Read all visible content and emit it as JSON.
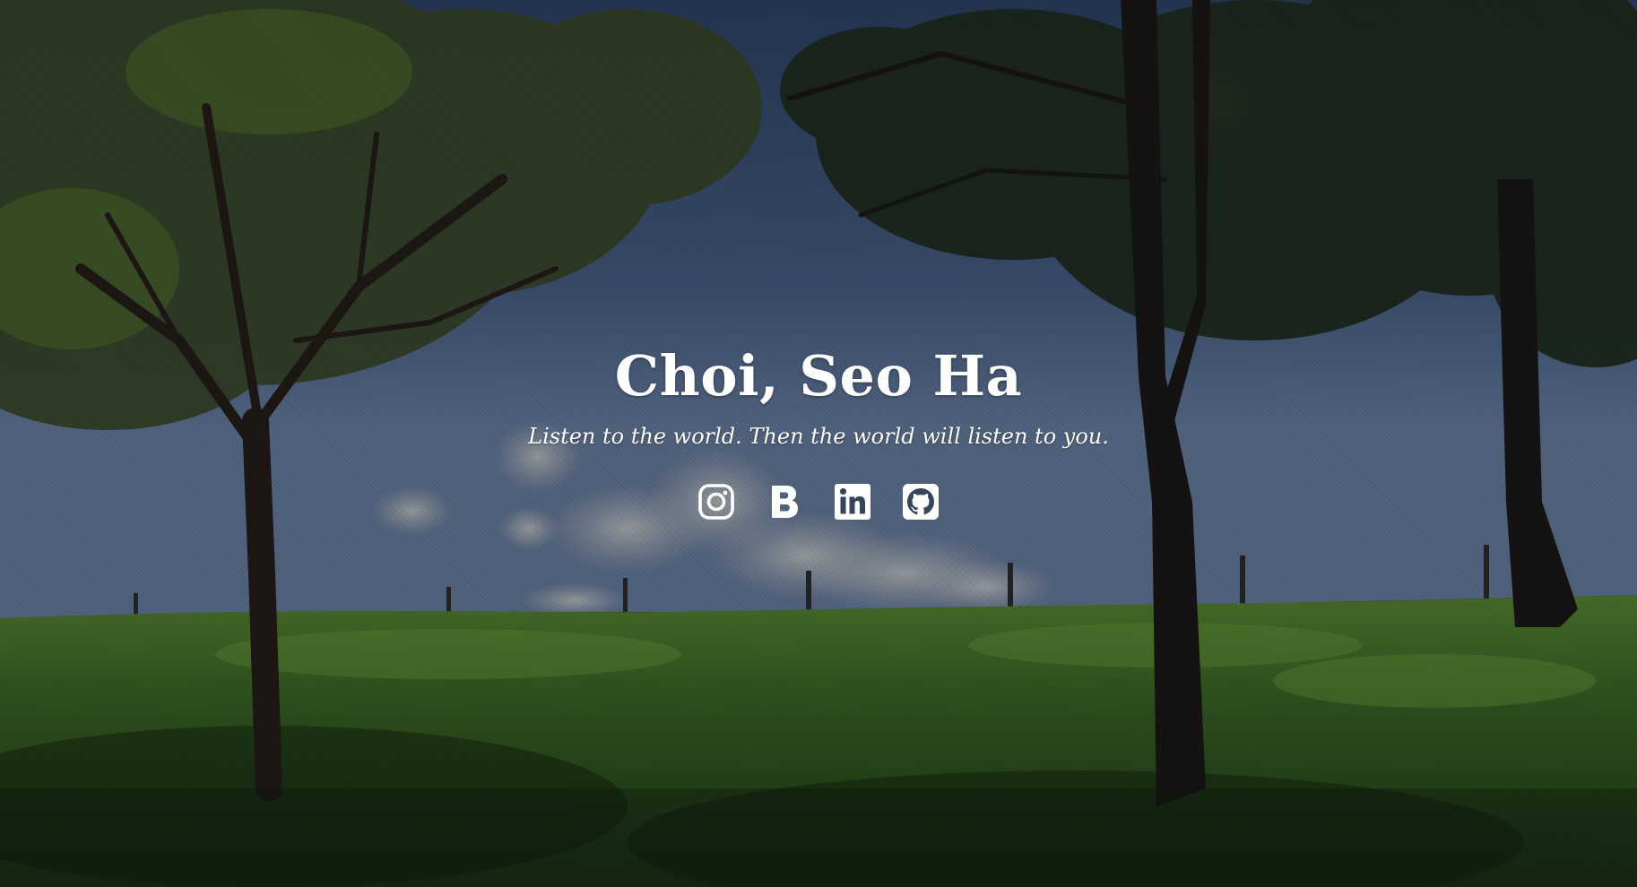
{
  "hero": {
    "title": "Choi, Seo Ha",
    "tagline": "Listen to the world. Then the world will listen to you."
  },
  "social_links": [
    {
      "icon": "instagram-icon",
      "label": "Instagram"
    },
    {
      "icon": "blog-icon",
      "label": "Blog"
    },
    {
      "icon": "linkedin-icon",
      "label": "LinkedIn"
    },
    {
      "icon": "github-icon",
      "label": "GitHub"
    }
  ],
  "colors": {
    "text": "#ffffff",
    "sky": "#3e5578",
    "grass": "#3f6a22",
    "foliage": "#2c3c1c"
  }
}
